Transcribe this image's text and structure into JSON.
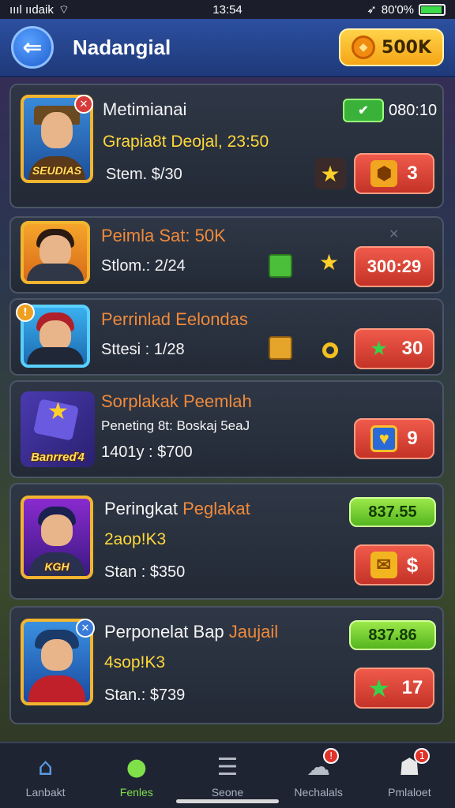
{
  "status_bar": {
    "carrier": "ıııl ııdaik",
    "time": "13:54",
    "battery": "80'0%"
  },
  "header": {
    "title": "Nadangial",
    "coins": "500K"
  },
  "cards": [
    {
      "name": "Metimianai",
      "subtitle": "Grapia8t Deojal, 23:50",
      "stat": "Stem. $/30",
      "timer": "080:10",
      "avatar_tag": "SEUDIAS",
      "button_value": "3",
      "button_icon": "shield-icon"
    },
    {
      "name": "Peimla Sat: 50K",
      "stat": "Stlom.: 2/24",
      "button_value": "300:29",
      "dismiss": "×"
    },
    {
      "name": "Perrinlad Eelondas",
      "stat": "Sttesi : 1/28",
      "button_value": "30",
      "button_icon": "star-icon"
    },
    {
      "name": "Sorplakak Peemlah",
      "subtitle": "Peneting 8t: Boskaj 5eaJ",
      "stat": "1401y : $700",
      "avatar_tag": "Banrreď4",
      "button_value": "9",
      "button_icon": "heart-icon"
    },
    {
      "name_white": "Peringkat",
      "name_orange": "Peglakat",
      "subtitle": "2aop!K3",
      "stat": "Stan : $350",
      "pill": "837.55",
      "avatar_tag": "KGH",
      "button_value": "$",
      "button_icon": "envelope-icon"
    },
    {
      "name_white": "Perponelat Bap",
      "name_orange": "Jaujail",
      "subtitle": "4sop!K3",
      "stat": "Stan.: $739",
      "pill": "837.86",
      "button_value": "17",
      "button_icon": "star-icon"
    }
  ],
  "nav": [
    {
      "label": "Lanbakt",
      "icon": "home-icon",
      "active": false
    },
    {
      "label": "Fenles",
      "icon": "chat-icon",
      "active": true
    },
    {
      "label": "Seone",
      "icon": "menu-icon",
      "active": false
    },
    {
      "label": "Nechalals",
      "icon": "bell-icon",
      "active": false,
      "badge": "!"
    },
    {
      "label": "Pmlaloet",
      "icon": "profile-icon",
      "active": false,
      "badge": "1"
    }
  ],
  "colors": {
    "accent_orange": "#f08a3a",
    "accent_yellow": "#ffd83a",
    "button_red": "#d8402f",
    "pill_green": "#7ed13a",
    "header_blue": "#2c4fa0"
  }
}
